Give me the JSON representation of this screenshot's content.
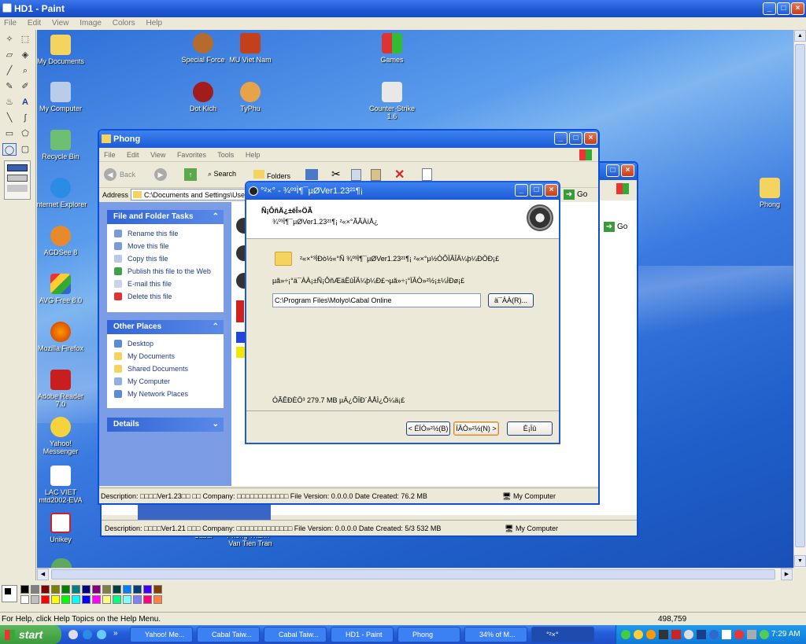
{
  "paint": {
    "title": "HD1 - Paint",
    "menu": [
      "File",
      "Edit",
      "View",
      "Image",
      "Colors",
      "Help"
    ],
    "status_help": "For Help, click Help Topics on the Help Menu.",
    "status_coords": "498,759"
  },
  "desktop": {
    "icons": [
      "My Documents",
      "Special Force",
      "MU Viet Nam",
      "Games",
      "My Computer",
      "Dot Kich",
      "TyPhu",
      "Counter-Strike 1.6",
      "Recycle Bin",
      "Internet Explorer",
      "ACDSee 8",
      "AVG Free 8.0",
      "Mozilla Firefox",
      "Adobe Reader 7.0",
      "Yahoo! Messenger",
      "LAC VIET mtd2002-EVA",
      "Unikey",
      "Phong",
      "Cabal",
      "Phong Thanh - Van Tien Tran"
    ]
  },
  "explorer": {
    "title": "Phong",
    "menu": [
      "File",
      "Edit",
      "View",
      "Favorites",
      "Tools",
      "Help"
    ],
    "toolbar": {
      "back": "Back",
      "search": "Search",
      "folders": "Folders"
    },
    "address_label": "Address",
    "address_value": "C:\\Documents and Settings\\User",
    "go": "Go",
    "tasks_title": "File and Folder Tasks",
    "tasks": [
      "Rename this file",
      "Move this file",
      "Copy this file",
      "Publish this file to the Web",
      "E-mail this file",
      "Delete this file"
    ],
    "places_title": "Other Places",
    "places": [
      "Desktop",
      "My Documents",
      "Shared Documents",
      "My Computer",
      "My Network Places"
    ],
    "details_title": "Details",
    "status_desc": "Description: □□□□Ver1.23□□ □□ Company: □□□□□□□□□□□□ File Version: 0.0.0.0 Date Created: 76.2 MB",
    "status_loc": "My Computer"
  },
  "explorer2": {
    "go": "Go",
    "status_desc": "Description: □□□□Ver1.21 □□□ Company: □□□□□□□□□□□□□ File Version: 0.0.0.0 Date Created: 5/3 532 MB",
    "status_loc": "My Computer"
  },
  "dialog": {
    "title": "°²×° - ¾º³Ì¶¯µØVer1.23²¹¶¡",
    "header_title": "Ñ¡ÔñÄ¿±êÎ»ÖÃ",
    "header_sub": "¾º³Ì¶¯µØVer1.23²¹¶¡ ²«×°ÃÃÀïÅ¿",
    "folder_text": "²«×°³ÌÐò½«°Ñ ¾º³Ì¶¯µØVer1.23²¹¶¡ ²«×°µ½ÒÔÏÂÎÄ¼þ¼ÐÖÐ¡£",
    "instruction": "µã»÷¡°ä¯ÀÀ¡±Ñ¡ÔñÆäËûÎÄ¼þ¼Ð£¬µã»÷¡°ÏÂÒ»²½¡±¼ÌÐø¡£",
    "path_value": "C:\\Program Files\\Molyo\\Cabal Online",
    "browse": "ä¯ÀÀ(R)...",
    "space": "ÓÃÊÐÈÖ³ 279.7 MB µÄ¿ÕÏÐ´ÅÅÌ¿Õ¼ä¡£",
    "back": "< ÉÏÒ»²½(B)",
    "next": "ÏÂÒ»²½(N) >",
    "cancel": "È¡Ïû"
  },
  "taskbar": {
    "start": "start",
    "tasks": [
      "Yahoo! Me...",
      "Cabal Taiw...",
      "Cabal Taiw...",
      "HD1 - Paint",
      "Phong",
      "34% of M...",
      "°²×°"
    ],
    "time": "7:29 AM"
  },
  "colors": {
    "palette": [
      "#000000",
      "#808080",
      "#800000",
      "#808000",
      "#008000",
      "#008080",
      "#000080",
      "#800080",
      "#808040",
      "#004040",
      "#0080ff",
      "#004080",
      "#4000ff",
      "#804000",
      "#ffffff",
      "#c0c0c0",
      "#ff0000",
      "#ffff00",
      "#00ff00",
      "#00ffff",
      "#0000ff",
      "#ff00ff",
      "#ffff80",
      "#00ff80",
      "#80ffff",
      "#8080ff",
      "#ff0080",
      "#ff8040"
    ]
  }
}
